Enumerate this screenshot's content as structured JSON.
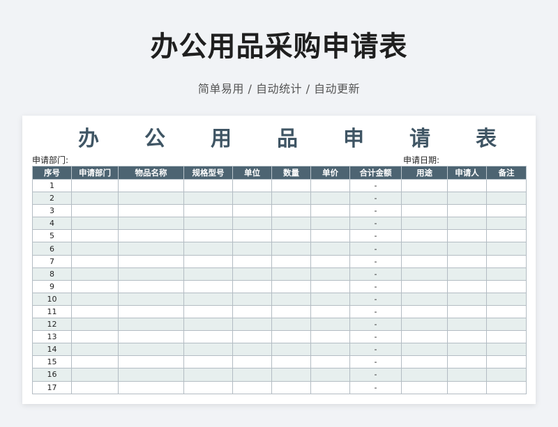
{
  "header": {
    "title": "办公用品采购申请表",
    "subtitle": "简单易用 / 自动统计 / 自动更新"
  },
  "sheet": {
    "title_chars": [
      "办",
      "公",
      "用",
      "品",
      "申",
      "请",
      "表"
    ],
    "department_label": "申请部门:",
    "date_label": "申请日期:",
    "columns": [
      "序号",
      "申请部门",
      "物品名称",
      "规格型号",
      "单位",
      "数量",
      "单价",
      "合计金额",
      "用途",
      "申请人",
      "备注"
    ],
    "rows": [
      {
        "no": "1",
        "total": "-"
      },
      {
        "no": "2",
        "total": "-"
      },
      {
        "no": "3",
        "total": "-"
      },
      {
        "no": "4",
        "total": "-"
      },
      {
        "no": "5",
        "total": "-"
      },
      {
        "no": "6",
        "total": "-"
      },
      {
        "no": "7",
        "total": "-"
      },
      {
        "no": "8",
        "total": "-"
      },
      {
        "no": "9",
        "total": "-"
      },
      {
        "no": "10",
        "total": "-"
      },
      {
        "no": "11",
        "total": "-"
      },
      {
        "no": "12",
        "total": "-"
      },
      {
        "no": "13",
        "total": "-"
      },
      {
        "no": "14",
        "total": "-"
      },
      {
        "no": "15",
        "total": "-"
      },
      {
        "no": "16",
        "total": "-"
      },
      {
        "no": "17",
        "total": "-"
      }
    ]
  },
  "colors": {
    "header_fill": "#4d6472",
    "title_color": "#3f5564",
    "alt_row": "#e7efee"
  }
}
